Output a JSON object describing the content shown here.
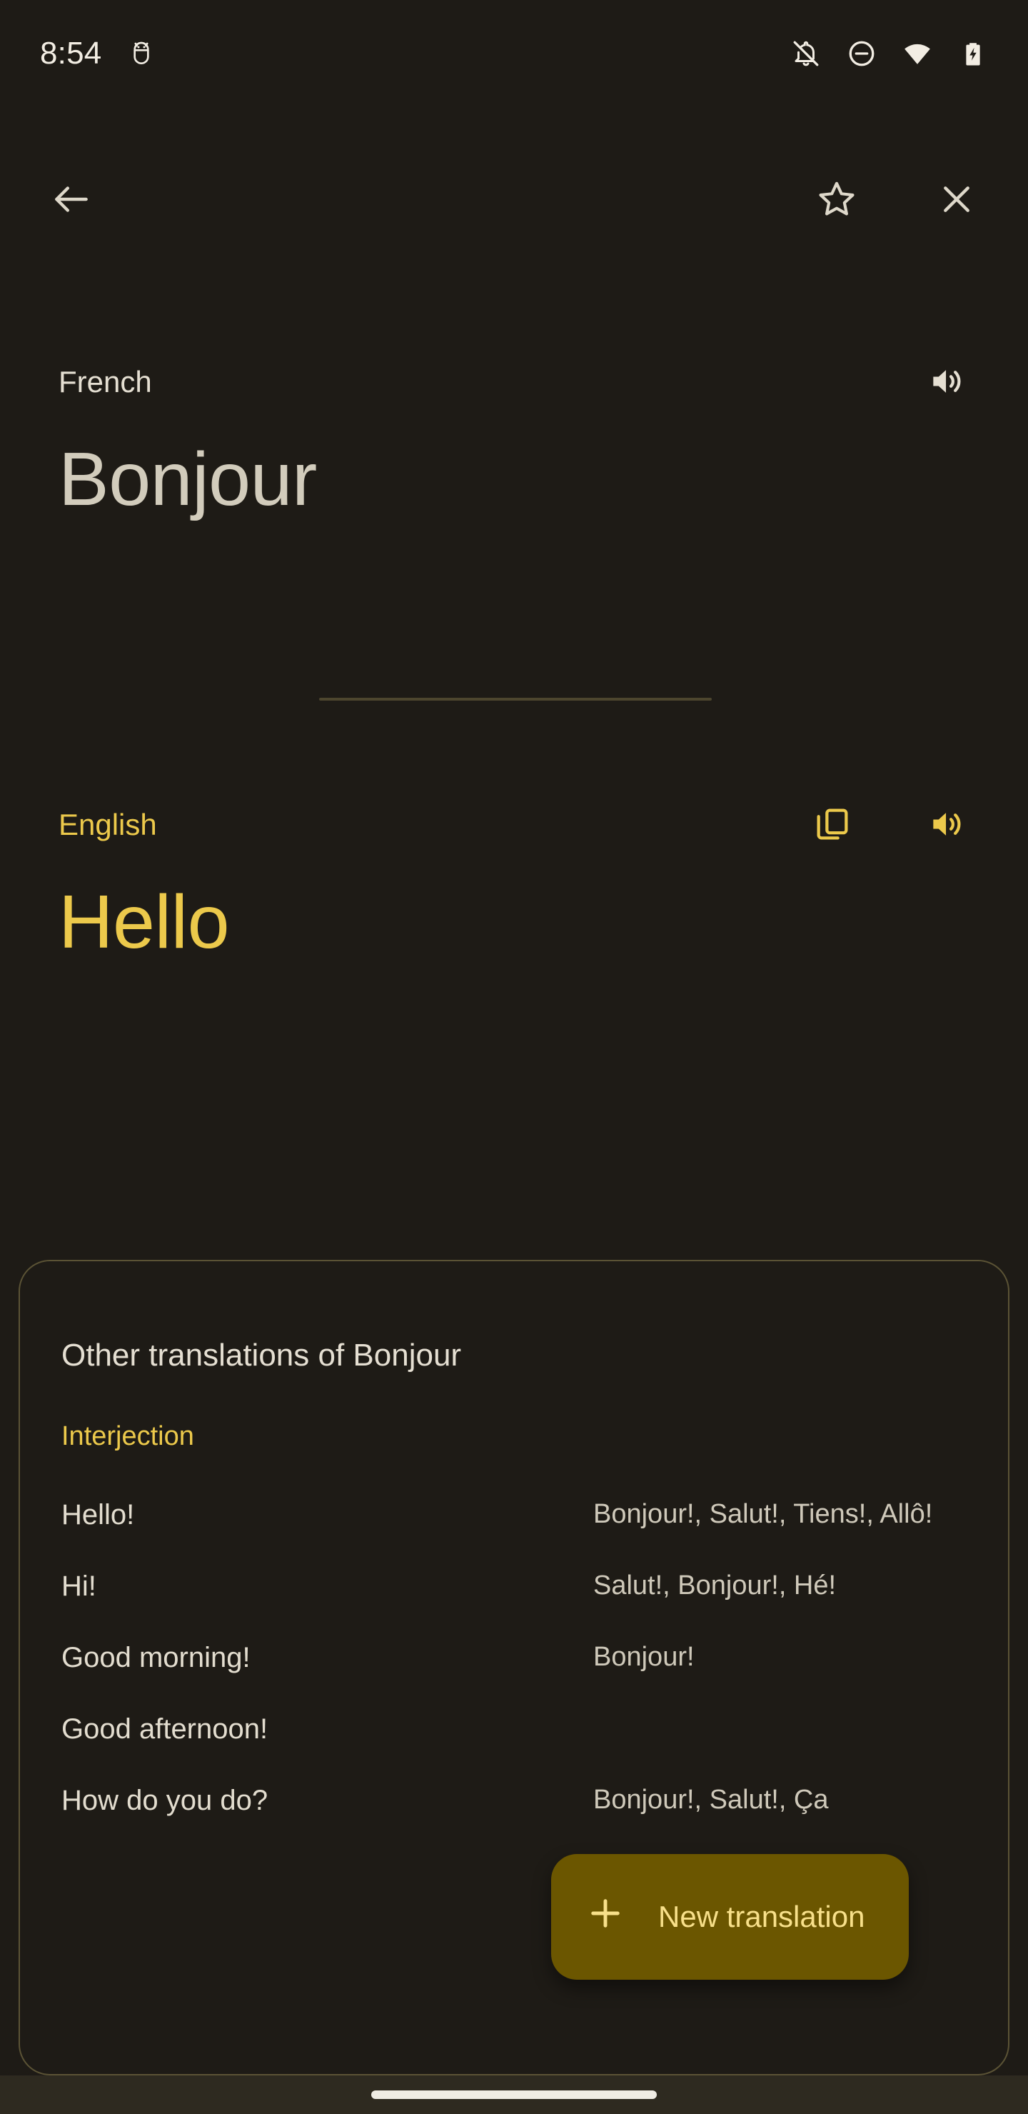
{
  "status_bar": {
    "clock": "8:54",
    "left_icons": [
      {
        "name": "android-bug-icon"
      }
    ],
    "right_icons": [
      {
        "name": "notifications-off-icon"
      },
      {
        "name": "do-not-disturb-icon"
      },
      {
        "name": "wifi-icon"
      },
      {
        "name": "battery-charging-icon"
      }
    ]
  },
  "app_bar": {
    "back": "back-arrow-icon",
    "star": "star-outline-icon",
    "close": "close-icon"
  },
  "source": {
    "language": "French",
    "text": "Bonjour",
    "listen_icon": "volume-up-icon"
  },
  "target": {
    "language": "English",
    "text": "Hello",
    "copy_icon": "copy-icon",
    "listen_icon": "volume-up-icon"
  },
  "other_translations": {
    "title": "Other translations of Bonjour",
    "part_of_speech": "Interjection",
    "rows": [
      {
        "term": "Hello!",
        "values": "Bonjour!, Salut!, Tiens!, Allô!"
      },
      {
        "term": "Hi!",
        "values": "Salut!, Bonjour!, Hé!"
      },
      {
        "term": "Good morning!",
        "values": "Bonjour!"
      },
      {
        "term": "Good afternoon!",
        "values": ""
      },
      {
        "term": "How do you do?",
        "values": "Bonjour!, Salut!, Ça"
      }
    ]
  },
  "fab": {
    "label": "New translation",
    "icon": "plus-icon"
  },
  "colors": {
    "background": "#1e1b16",
    "accent": "#ecc94b",
    "on_surface": "#e5dfd2",
    "divider": "#4d462e",
    "card_border": "#5b5335",
    "fab_background": "#6b5600",
    "fab_label": "#f8e08a",
    "nav_bar": "#2e2a20"
  }
}
